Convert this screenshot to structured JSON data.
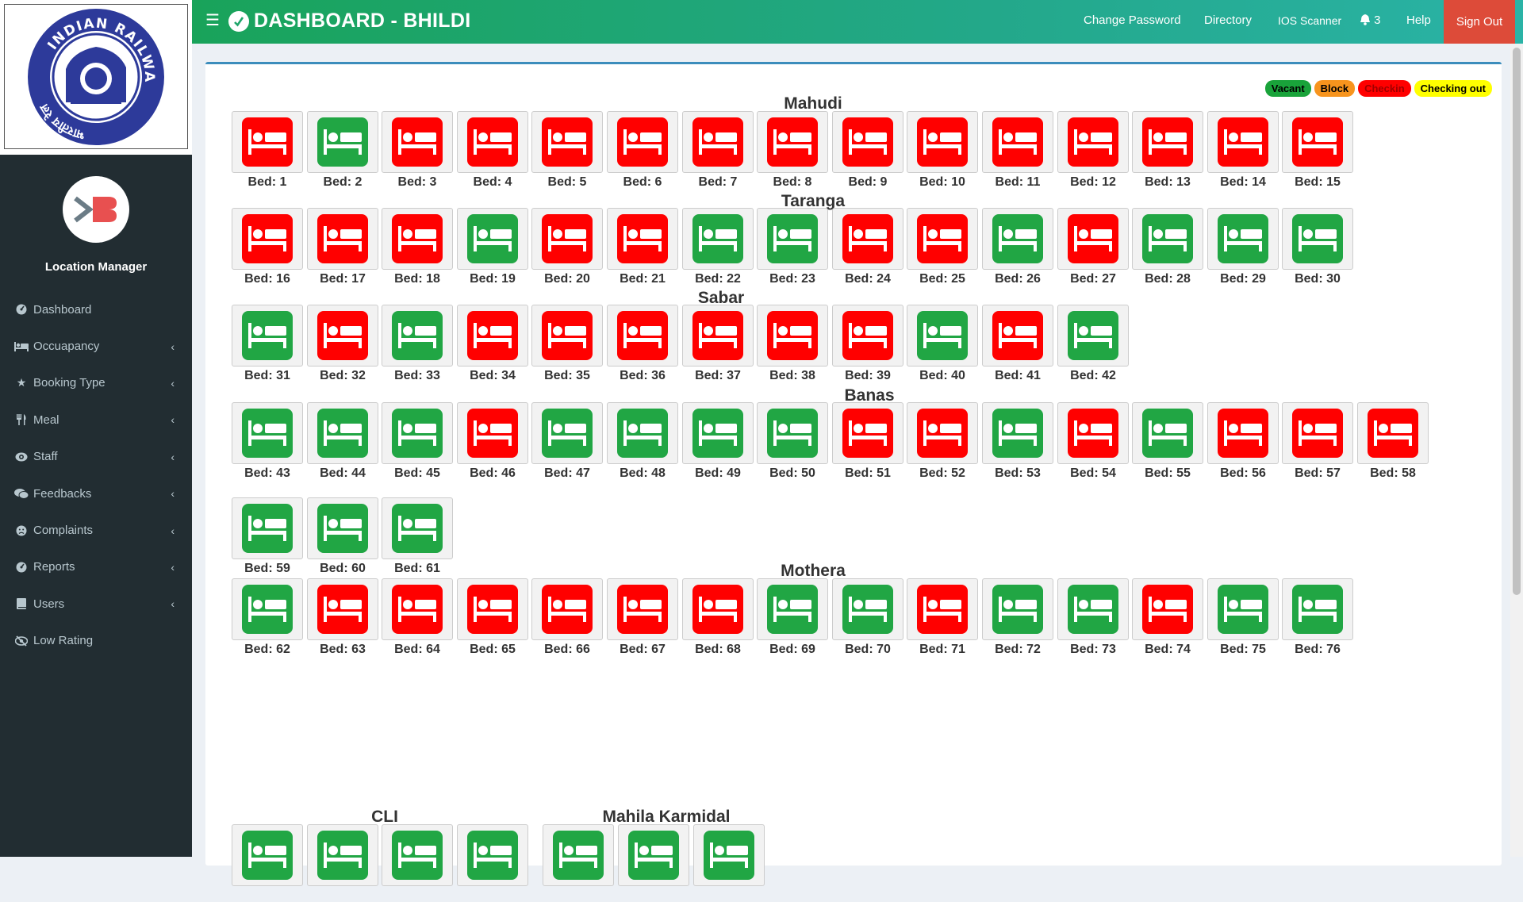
{
  "header": {
    "title": "DASHBOARD - BHILDI",
    "nav": [
      "Change Password",
      "Directory",
      "IOS Scanner"
    ],
    "notification_count": "3",
    "help": "Help",
    "sign_out": "Sign Out"
  },
  "logo": {
    "text_top": "INDIAN RAILWAYS",
    "text_left": "भारतीय रेल"
  },
  "sidebar": {
    "role": "Location Manager",
    "items": [
      {
        "label": "Dashboard",
        "icon": "dashboard-icon",
        "expandable": false
      },
      {
        "label": "Occuapancy",
        "icon": "bed-icon",
        "expandable": true
      },
      {
        "label": "Booking Type",
        "icon": "star-icon",
        "expandable": true
      },
      {
        "label": "Meal",
        "icon": "cutlery-icon",
        "expandable": true
      },
      {
        "label": "Staff",
        "icon": "eye-icon",
        "expandable": true
      },
      {
        "label": "Feedbacks",
        "icon": "comments-icon",
        "expandable": true
      },
      {
        "label": "Complaints",
        "icon": "frown-icon",
        "expandable": true
      },
      {
        "label": "Reports",
        "icon": "dashboard-icon",
        "expandable": true
      },
      {
        "label": "Users",
        "icon": "book-icon",
        "expandable": true
      },
      {
        "label": "Low Rating",
        "icon": "eye-slash-icon",
        "expandable": false
      }
    ]
  },
  "legend": [
    {
      "label": "Vacant",
      "bg": "#19a33a",
      "fg": "#000000"
    },
    {
      "label": "Block",
      "bg": "#f7941d",
      "fg": "#000000"
    },
    {
      "label": "Checkin",
      "bg": "#ff0000",
      "fg": "#a00000"
    },
    {
      "label": "Checking out",
      "bg": "#ffff00",
      "fg": "#000000"
    }
  ],
  "colors": {
    "vacant": "#21a644",
    "checkin": "#ff0000"
  },
  "bed_label_prefix": "Bed: ",
  "sections": [
    {
      "name": "Mahudi",
      "beds": [
        {
          "n": 1,
          "s": "checkin"
        },
        {
          "n": 2,
          "s": "vacant"
        },
        {
          "n": 3,
          "s": "checkin"
        },
        {
          "n": 4,
          "s": "checkin"
        },
        {
          "n": 5,
          "s": "checkin"
        },
        {
          "n": 6,
          "s": "checkin"
        },
        {
          "n": 7,
          "s": "checkin"
        },
        {
          "n": 8,
          "s": "checkin"
        },
        {
          "n": 9,
          "s": "checkin"
        },
        {
          "n": 10,
          "s": "checkin"
        },
        {
          "n": 11,
          "s": "checkin"
        },
        {
          "n": 12,
          "s": "checkin"
        },
        {
          "n": 13,
          "s": "checkin"
        },
        {
          "n": 14,
          "s": "checkin"
        },
        {
          "n": 15,
          "s": "checkin"
        }
      ]
    },
    {
      "name": "Taranga",
      "beds": [
        {
          "n": 16,
          "s": "checkin"
        },
        {
          "n": 17,
          "s": "checkin"
        },
        {
          "n": 18,
          "s": "checkin"
        },
        {
          "n": 19,
          "s": "vacant"
        },
        {
          "n": 20,
          "s": "checkin"
        },
        {
          "n": 21,
          "s": "checkin"
        },
        {
          "n": 22,
          "s": "vacant"
        },
        {
          "n": 23,
          "s": "vacant"
        },
        {
          "n": 24,
          "s": "checkin"
        },
        {
          "n": 25,
          "s": "checkin"
        },
        {
          "n": 26,
          "s": "vacant"
        },
        {
          "n": 27,
          "s": "checkin"
        },
        {
          "n": 28,
          "s": "vacant"
        },
        {
          "n": 29,
          "s": "vacant"
        },
        {
          "n": 30,
          "s": "vacant"
        }
      ]
    },
    {
      "name": "Sabar",
      "beds": [
        {
          "n": 31,
          "s": "vacant"
        },
        {
          "n": 32,
          "s": "checkin"
        },
        {
          "n": 33,
          "s": "vacant"
        },
        {
          "n": 34,
          "s": "checkin"
        },
        {
          "n": 35,
          "s": "checkin"
        },
        {
          "n": 36,
          "s": "checkin"
        },
        {
          "n": 37,
          "s": "checkin"
        },
        {
          "n": 38,
          "s": "checkin"
        },
        {
          "n": 39,
          "s": "checkin"
        },
        {
          "n": 40,
          "s": "vacant"
        },
        {
          "n": 41,
          "s": "checkin"
        },
        {
          "n": 42,
          "s": "vacant"
        }
      ]
    },
    {
      "name": "Banas",
      "beds": [
        {
          "n": 43,
          "s": "vacant"
        },
        {
          "n": 44,
          "s": "vacant"
        },
        {
          "n": 45,
          "s": "vacant"
        },
        {
          "n": 46,
          "s": "checkin"
        },
        {
          "n": 47,
          "s": "vacant"
        },
        {
          "n": 48,
          "s": "vacant"
        },
        {
          "n": 49,
          "s": "vacant"
        },
        {
          "n": 50,
          "s": "vacant"
        },
        {
          "n": 51,
          "s": "checkin"
        },
        {
          "n": 52,
          "s": "checkin"
        },
        {
          "n": 53,
          "s": "vacant"
        },
        {
          "n": 54,
          "s": "checkin"
        },
        {
          "n": 55,
          "s": "vacant"
        },
        {
          "n": 56,
          "s": "checkin"
        },
        {
          "n": 57,
          "s": "checkin"
        },
        {
          "n": 58,
          "s": "checkin"
        },
        {
          "n": 59,
          "s": "vacant"
        },
        {
          "n": 60,
          "s": "vacant"
        },
        {
          "n": 61,
          "s": "vacant"
        }
      ]
    },
    {
      "name": "Mothera",
      "beds": [
        {
          "n": 62,
          "s": "vacant"
        },
        {
          "n": 63,
          "s": "checkin"
        },
        {
          "n": 64,
          "s": "checkin"
        },
        {
          "n": 65,
          "s": "checkin"
        },
        {
          "n": 66,
          "s": "checkin"
        },
        {
          "n": 67,
          "s": "checkin"
        },
        {
          "n": 68,
          "s": "checkin"
        },
        {
          "n": 69,
          "s": "vacant"
        },
        {
          "n": 70,
          "s": "vacant"
        },
        {
          "n": 71,
          "s": "checkin"
        },
        {
          "n": 72,
          "s": "vacant"
        },
        {
          "n": 73,
          "s": "vacant"
        },
        {
          "n": 74,
          "s": "checkin"
        },
        {
          "n": 75,
          "s": "vacant"
        },
        {
          "n": 76,
          "s": "vacant"
        }
      ]
    },
    {
      "name": "CLI",
      "beds": [
        {
          "n": null,
          "s": "vacant"
        },
        {
          "n": null,
          "s": "vacant"
        },
        {
          "n": null,
          "s": "vacant"
        },
        {
          "n": null,
          "s": "vacant"
        }
      ]
    },
    {
      "name": "Mahila Karmidal",
      "beds": [
        {
          "n": null,
          "s": "vacant"
        },
        {
          "n": null,
          "s": "vacant"
        },
        {
          "n": null,
          "s": "vacant"
        }
      ]
    }
  ]
}
